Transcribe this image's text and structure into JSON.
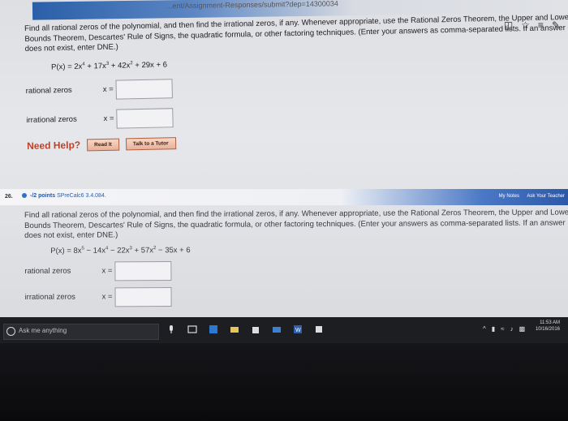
{
  "browser": {
    "url": "...ent/Assignment-Responses/submit?dep=14300034",
    "icons": [
      "reading-view-icon",
      "favorite-star-icon",
      "hub-icon",
      "notes-icon"
    ]
  },
  "question1": {
    "instructions": [
      "Find all rational zeros of the polynomial, and then find the irrational zeros, if any. Whenever appropriate, use the Rational Zeros Theorem, the Upper and Lower",
      "Bounds Theorem, Descartes' Rule of Signs, the quadratic formula, or other factoring techniques. (Enter your answers as comma-separated lists. If an answer",
      "does not exist, enter DNE.)"
    ],
    "polynomial": {
      "lhs": "P(x) = 2x",
      "e1": "4",
      "t2": " + 17x",
      "e2": "3",
      "t3": " + 42x",
      "e3": "2",
      "t4": " + 29x + 6"
    },
    "rational_label": "rational zeros",
    "irrational_label": "irrational zeros",
    "x_label": "x =",
    "rational_value": "",
    "irrational_value": "",
    "need_help": "Need Help?",
    "read_it": "Read It",
    "talk_tutor": "Talk to a Tutor"
  },
  "question2": {
    "number": "26.",
    "points": "-/2 points",
    "source": "SPreCalc6 3.4.084.",
    "my_notes": "My Notes",
    "ask_teacher": "Ask Your Teacher",
    "instructions": [
      "Find all rational zeros of the polynomial, and then find the irrational zeros, if any. Whenever appropriate, use the Rational Zeros Theorem, the Upper and Lower",
      "Bounds Theorem, Descartes' Rule of Signs, the quadratic formula, or other factoring techniques. (Enter your answers as comma-separated lists. If an answer",
      "does not exist, enter DNE.)"
    ],
    "polynomial": {
      "lhs": "P(x) = 8x",
      "e1": "5",
      "t2": " − 14x",
      "e2": "4",
      "t3": " − 22x",
      "e3": "3",
      "t4": " + 57x",
      "e4": "2",
      "t5": " − 35x + 6"
    },
    "rational_label": "rational zeros",
    "irrational_label": "irrational zeros",
    "x_label": "x =",
    "rational_value": "",
    "irrational_value": ""
  },
  "taskbar": {
    "search_placeholder": "Ask me anything",
    "time": "11:53 AM",
    "date": "10/16/2016"
  }
}
